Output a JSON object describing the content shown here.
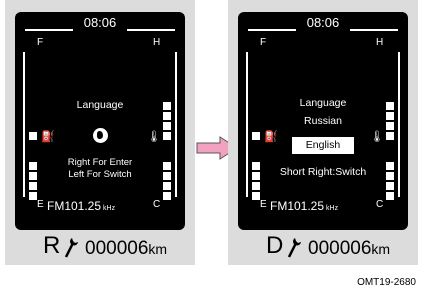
{
  "left_panel": {
    "clock": "08:06",
    "fuel_full": "F",
    "fuel_empty": "E",
    "temp_hot": "H",
    "temp_cold": "C",
    "title": "Language",
    "line1": "Right For Enter",
    "line2": "Left For Switch",
    "radio_band_freq": "FM101.25",
    "radio_unit": "kHz",
    "gear": "R",
    "odometer": "000006",
    "odometer_unit": "km"
  },
  "right_panel": {
    "clock": "08:06",
    "fuel_full": "F",
    "fuel_empty": "E",
    "temp_hot": "H",
    "temp_cold": "C",
    "title": "Language",
    "current_language": "Russian",
    "selected_option": "English",
    "hint": "Short Right:Switch",
    "radio_band_freq": "FM101.25",
    "radio_unit": "kHz",
    "gear": "D",
    "odometer": "000006",
    "odometer_unit": "km"
  },
  "figure_code": "OMT19-2680",
  "colors": {
    "screen": "#000000",
    "frame": "#dcdcdc",
    "arrow": "#f2a2c0"
  },
  "icons": [
    "fuel-pump-icon",
    "globe-icon",
    "coolant-temp-icon",
    "wrench-icon",
    "arrow-right-icon"
  ]
}
